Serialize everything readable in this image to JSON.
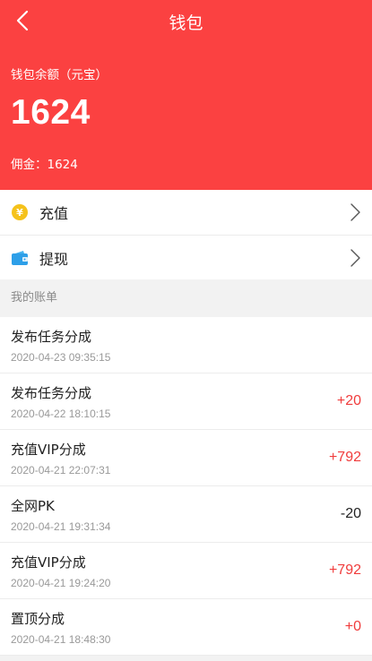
{
  "header": {
    "title": "钱包",
    "back_icon": "chevron-left-icon",
    "balance_label": "钱包余额（元宝）",
    "balance_value": "1624",
    "commission": "佣金：1624",
    "background_color": "#fb4141"
  },
  "actions": [
    {
      "label": "充值",
      "icon": "coin-yen-icon"
    },
    {
      "label": "提现",
      "icon": "wallet-icon"
    }
  ],
  "bill_section_title": "我的账单",
  "bills": [
    {
      "title": "发布任务分成",
      "time": "2020-04-23 09:35:15",
      "amount": ""
    },
    {
      "title": "发布任务分成",
      "time": "2020-04-22 18:10:15",
      "amount": "+20"
    },
    {
      "title": "充值VIP分成",
      "time": "2020-04-21 22:07:31",
      "amount": "+792"
    },
    {
      "title": "全网PK",
      "time": "2020-04-21 19:31:34",
      "amount": "-20"
    },
    {
      "title": "充值VIP分成",
      "time": "2020-04-21 19:24:20",
      "amount": "+792"
    },
    {
      "title": "置顶分成",
      "time": "2020-04-21 18:48:30",
      "amount": "+0"
    }
  ],
  "colors": {
    "positive_amount": "#f03c3c",
    "negative_amount": "#222222"
  }
}
